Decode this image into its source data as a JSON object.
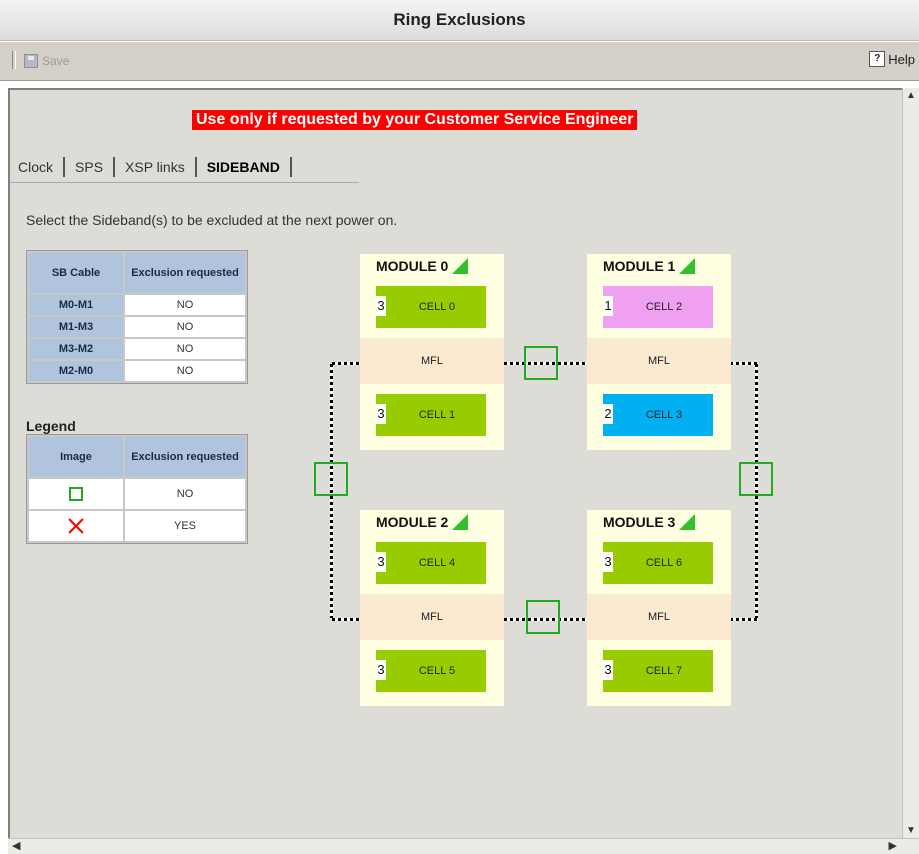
{
  "window": {
    "title": "Ring Exclusions"
  },
  "toolbar": {
    "save_label": "Save",
    "help_label": "Help",
    "help_icon": "?"
  },
  "warning": "Use only if requested by your Customer Service Engineer",
  "tabs": [
    {
      "label": "Clock",
      "active": false
    },
    {
      "label": "SPS",
      "active": false
    },
    {
      "label": "XSP links",
      "active": false
    },
    {
      "label": "SIDEBAND",
      "active": true
    }
  ],
  "instruction": "Select the Sideband(s) to be excluded at the next power on.",
  "sb_table": {
    "headers": [
      "SB Cable",
      "Exclusion requested"
    ],
    "rows": [
      {
        "cable": "M0-M1",
        "value": "NO"
      },
      {
        "cable": "M1-M3",
        "value": "NO"
      },
      {
        "cable": "M3-M2",
        "value": "NO"
      },
      {
        "cable": "M2-M0",
        "value": "NO"
      }
    ]
  },
  "legend": {
    "title": "Legend",
    "headers": [
      "Image",
      "Exclusion requested"
    ],
    "rows": [
      {
        "icon": "green-square-icon",
        "value": "NO"
      },
      {
        "icon": "red-x-icon",
        "value": "YES"
      }
    ]
  },
  "modules": [
    {
      "name": "MODULE 0",
      "mfl": "MFL",
      "cells": [
        {
          "num": "3",
          "label": "CELL 0",
          "color": "#99cc00"
        },
        {
          "num": "3",
          "label": "CELL 1",
          "color": "#99cc00"
        }
      ]
    },
    {
      "name": "MODULE 1",
      "mfl": "MFL",
      "cells": [
        {
          "num": "1",
          "label": "CELL 2",
          "color": "#f0a0f0"
        },
        {
          "num": "2",
          "label": "CELL 3",
          "color": "#00b0f0"
        }
      ]
    },
    {
      "name": "MODULE 2",
      "mfl": "MFL",
      "cells": [
        {
          "num": "3",
          "label": "CELL 4",
          "color": "#99cc00"
        },
        {
          "num": "3",
          "label": "CELL 5",
          "color": "#99cc00"
        }
      ]
    },
    {
      "name": "MODULE 3",
      "mfl": "MFL",
      "cells": [
        {
          "num": "3",
          "label": "CELL 6",
          "color": "#99cc00"
        },
        {
          "num": "3",
          "label": "CELL 7",
          "color": "#99cc00"
        }
      ]
    }
  ],
  "colors": {
    "exclusion_ok": "#22aa22",
    "exclusion_yes": "#ff0000",
    "warning_bg": "#ff0000"
  }
}
